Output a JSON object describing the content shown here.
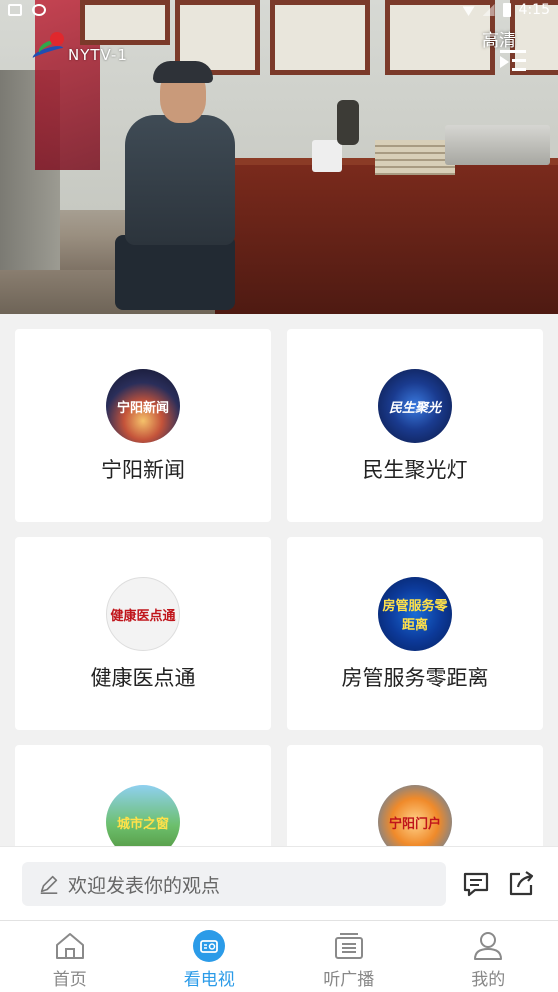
{
  "status_bar": {
    "time": "4:15"
  },
  "player": {
    "channel_logo_text": "NYTV-1",
    "quality_label": "高清",
    "playlist_icon": "playlist-icon"
  },
  "programs": [
    {
      "title": "宁阳新闻",
      "thumb_text": "宁阳新闻"
    },
    {
      "title": "民生聚光灯",
      "thumb_text": "民生聚光"
    },
    {
      "title": "健康医点通",
      "thumb_text": "健康医点通"
    },
    {
      "title": "房管服务零距离",
      "thumb_text": "房管服务零距离"
    },
    {
      "title": "",
      "thumb_text": "城市之窗"
    },
    {
      "title": "",
      "thumb_text": "宁阳门户"
    }
  ],
  "comment": {
    "placeholder": "欢迎发表你的观点",
    "icons": [
      "pencil-icon",
      "comment-icon",
      "share-icon"
    ]
  },
  "tabs": [
    {
      "label": "首页",
      "icon": "home-icon",
      "active": false
    },
    {
      "label": "看电视",
      "icon": "tv-icon",
      "active": true
    },
    {
      "label": "听广播",
      "icon": "radio-icon",
      "active": false
    },
    {
      "label": "我的",
      "icon": "user-icon",
      "active": false
    }
  ],
  "colors": {
    "accent": "#2b9be8",
    "background": "#f1f1f1"
  }
}
